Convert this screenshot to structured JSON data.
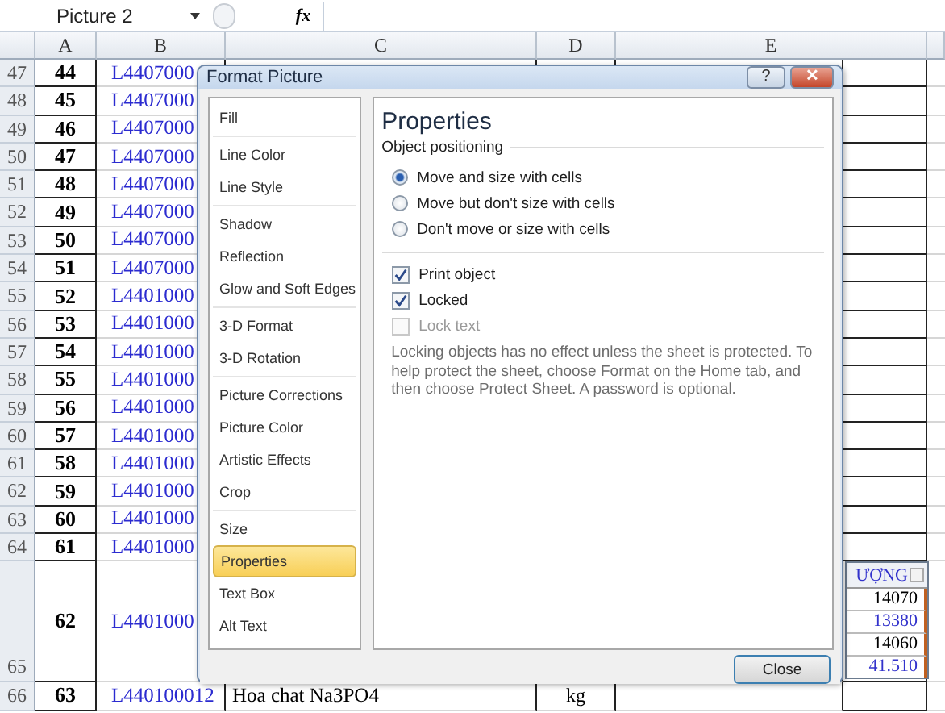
{
  "formula_bar": {
    "name_box": "Picture 2",
    "function_button": "fx"
  },
  "sheet": {
    "columns": [
      "A",
      "B",
      "C",
      "D",
      "E"
    ],
    "rows": [
      {
        "header": "47",
        "a": "44",
        "b": "L4407000"
      },
      {
        "header": "48",
        "a": "45",
        "b": "L4407000"
      },
      {
        "header": "49",
        "a": "46",
        "b": "L4407000"
      },
      {
        "header": "50",
        "a": "47",
        "b": "L4407000"
      },
      {
        "header": "51",
        "a": "48",
        "b": "L4407000"
      },
      {
        "header": "52",
        "a": "49",
        "b": "L4407000"
      },
      {
        "header": "53",
        "a": "50",
        "b": "L4407000"
      },
      {
        "header": "54",
        "a": "51",
        "b": "L4407000"
      },
      {
        "header": "55",
        "a": "52",
        "b": "L4401000"
      },
      {
        "header": "56",
        "a": "53",
        "b": "L4401000"
      },
      {
        "header": "57",
        "a": "54",
        "b": "L4401000"
      },
      {
        "header": "58",
        "a": "55",
        "b": "L4401000"
      },
      {
        "header": "59",
        "a": "56",
        "b": "L4401000"
      },
      {
        "header": "60",
        "a": "57",
        "b": "L4401000"
      },
      {
        "header": "61",
        "a": "58",
        "b": "L4401000"
      },
      {
        "header": "62",
        "a": "59",
        "b": "L4401000"
      },
      {
        "header": "63",
        "a": "60",
        "b": "L4401000"
      },
      {
        "header": "64",
        "a": "61",
        "b": "L4401000"
      },
      {
        "header": "65",
        "a": "62",
        "b": "L4401000",
        "kind": "tall"
      },
      {
        "header": "66",
        "a": "63",
        "b": "L440100012",
        "c": "Hoa chat Na3PO4",
        "d": "kg"
      }
    ]
  },
  "embedded_picture": {
    "header": "ƯỢNG",
    "values": [
      {
        "text": "14070",
        "color": "#000000"
      },
      {
        "text": "13380",
        "color": "#3333cc"
      },
      {
        "text": "14060",
        "color": "#000000"
      },
      {
        "text": "41.510",
        "color": "#3333cc"
      }
    ]
  },
  "dialog": {
    "title": "Format Picture",
    "help_button": "?",
    "close_icon": "✕",
    "nav_groups": [
      {
        "items": [
          {
            "label": "Fill",
            "selected": false
          }
        ]
      },
      {
        "items": [
          {
            "label": "Line Color",
            "selected": false
          },
          {
            "label": "Line Style",
            "selected": false
          }
        ]
      },
      {
        "items": [
          {
            "label": "Shadow",
            "selected": false
          },
          {
            "label": "Reflection",
            "selected": false
          },
          {
            "label": "Glow and Soft Edges",
            "selected": false
          }
        ]
      },
      {
        "items": [
          {
            "label": "3-D Format",
            "selected": false
          },
          {
            "label": "3-D Rotation",
            "selected": false
          }
        ]
      },
      {
        "items": [
          {
            "label": "Picture Corrections",
            "selected": false
          },
          {
            "label": "Picture Color",
            "selected": false
          },
          {
            "label": "Artistic Effects",
            "selected": false
          },
          {
            "label": "Crop",
            "selected": false
          }
        ]
      },
      {
        "items": [
          {
            "label": "Size",
            "selected": false
          },
          {
            "label": "Properties",
            "selected": true
          },
          {
            "label": "Text Box",
            "selected": false
          },
          {
            "label": "Alt Text",
            "selected": false
          }
        ]
      }
    ],
    "heading": "Properties",
    "section": "Object positioning",
    "radios": [
      {
        "label": "Move and size with cells",
        "selected": true
      },
      {
        "label": "Move but don't size with cells",
        "selected": false
      },
      {
        "label": "Don't move or size with cells",
        "selected": false
      }
    ],
    "checkboxes": [
      {
        "label": "Print object",
        "checked": true,
        "disabled": false
      },
      {
        "label": "Locked",
        "checked": true,
        "disabled": false
      },
      {
        "label": "Lock text",
        "checked": false,
        "disabled": true
      }
    ],
    "note": "Locking objects has no effect unless the sheet is protected. To help protect the sheet, choose Format on the Home tab, and then choose Protect Sheet. A password is optional.",
    "close_button": "Close"
  }
}
